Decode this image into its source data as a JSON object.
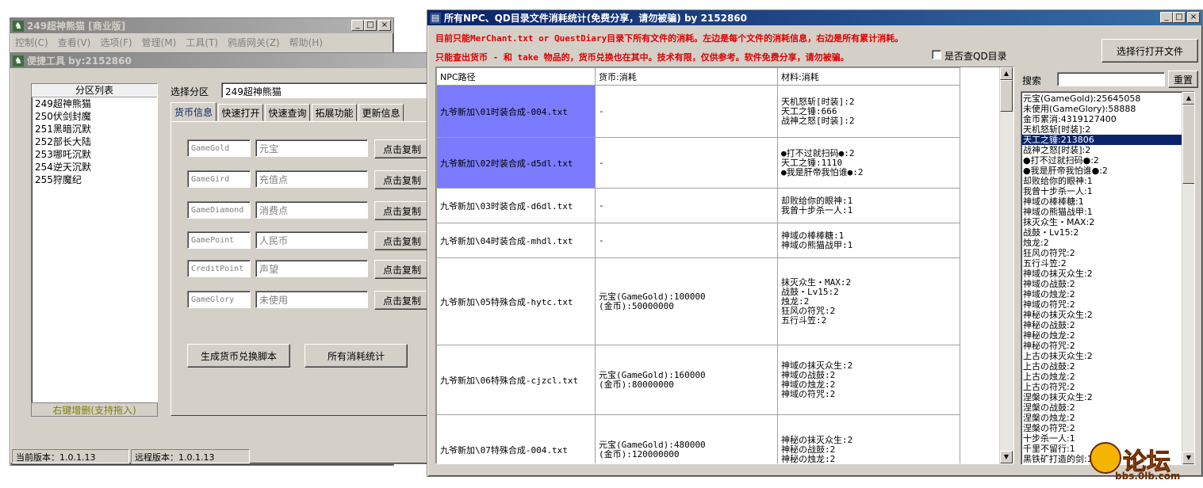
{
  "main_window": {
    "title": "249超神熊猫 [商业版]",
    "menu": [
      "控制(C)",
      "查看(V)",
      "选项(F)",
      "管理(M)",
      "工具(T)",
      "鸦盾网关(Z)",
      "帮助(H)"
    ]
  },
  "tool_window": {
    "title": "便捷工具   by:2152860",
    "partition_list_header": "分区列表",
    "partitions": [
      "249超神熊猫",
      "250伏剑封魔",
      "251黑暗沉默",
      "252部长大陆",
      "253哪吒沉默",
      "254逆天沉默",
      "255狩魔纪"
    ],
    "list_footer": "右键增删(支持拖入)",
    "select_partition_label": "选择分区",
    "selected_partition": "249超神熊猫",
    "tabs": [
      "货币信息",
      "快速打开",
      "快速查询",
      "拓展功能",
      "更新信息"
    ],
    "currency_rows": [
      {
        "code": "GameGold",
        "name": "元宝",
        "button": "点击复制"
      },
      {
        "code": "GameGird",
        "name": "充值点",
        "button": "点击复制"
      },
      {
        "code": "GameDiamond",
        "name": "消费点",
        "button": "点击复制"
      },
      {
        "code": "GamePoint",
        "name": "人民币",
        "button": "点击复制"
      },
      {
        "code": "CreditPoint",
        "name": "声望",
        "button": "点击复制"
      },
      {
        "code": "GameGlory",
        "name": "未使用",
        "button": "点击复制"
      }
    ],
    "generate_button": "生成货币兑换脚本",
    "stats_button": "所有消耗统计",
    "current_version": "当前版本：1.0.1.13",
    "remote_version": "远程版本：1.0.1.13"
  },
  "stats_window": {
    "title": "所有NPC、QD目录文件消耗统计(免费分享，请勿被骗)     by 2152860",
    "notice_line1": "目前只能MerChant.txt or QuestDiary目录下所有文件的消耗。左边是每个文件的消耗信息，右边是所有累计消耗。",
    "notice_line2": "只能查出货币 - 和 take 物品的，货币兑换也在其中。技术有限，仅供参考。软件免费分享，请勿被骗。",
    "checkbox_label": "是否查QD目录",
    "open_file_button": "选择行打开文件",
    "search_label": "搜索",
    "search_value": "",
    "reset_button": "重置",
    "table_headers": [
      "NPC路径",
      "货币:消耗",
      "材料:消耗"
    ],
    "rows": [
      {
        "path": "九爷新加\\01时装合成-004.txt",
        "currency": [
          "-"
        ],
        "materials": [
          "天机怒斩[时装]:2",
          "天工之锤:666",
          "战神之怒[时装]:2"
        ],
        "selected": true
      },
      {
        "path": "九爷新加\\02时装合成-d5dl.txt",
        "currency": [
          "-"
        ],
        "materials": [
          "●打不过就扫码●:2",
          "天工之锤:1110",
          "●我是肝帝我怕谁●:2"
        ],
        "selected": true
      },
      {
        "path": "九爷新加\\03时装合成-d6dl.txt",
        "currency": [
          "-"
        ],
        "materials": [
          "却败给你的眼神:1",
          "我曾十步杀一人:1"
        ],
        "selected": false
      },
      {
        "path": "九爷新加\\04时装合成-mhdl.txt",
        "currency": [
          "-"
        ],
        "materials": [
          "神域の棒棒糖:1",
          "神域の熊猫战甲:1"
        ],
        "selected": false
      },
      {
        "path": "九爷新加\\05特殊合成-hytc.txt",
        "currency": [
          "元宝(GameGold):100000",
          "(金币):50000000"
        ],
        "materials": [
          "抹灭众生・MAX:2",
          "战鼓・Lv15:2",
          "烛龙:2",
          "狂风の符咒:2",
          "五行斗笠:2"
        ],
        "selected": false
      },
      {
        "path": "九爷新加\\06特殊合成-cjzcl.txt",
        "currency": [
          "元宝(GameGold):160000",
          "(金币):80000000"
        ],
        "materials": [
          "神域の抹灭众生:2",
          "神域の战鼓:2",
          "神域の烛龙:2",
          "神域の符咒:2"
        ],
        "selected": false
      },
      {
        "path": "九爷新加\\07特殊合成-004.txt",
        "currency": [
          "元宝(GameGold):480000",
          "(金币):120000000"
        ],
        "materials": [
          "神秘の抹灭众生:2",
          "神秘の战鼓:2",
          "神秘の烛龙:2"
        ],
        "selected": false
      }
    ],
    "summary": [
      "元宝(GameGold):25645058",
      "未使用(GameGlory):58888",
      "金币累消:4319127400",
      "天机怒斩[时装]:2",
      "天工之锤:213806",
      "战神之怒[时装]:2",
      "●打不过就扫码●:2",
      "●我是肝帝我怕谁●:2",
      "却败给你的眼神:1",
      "我曾十步杀一人:1",
      "神域の棒棒糖:1",
      "神域の熊猫战甲:1",
      "抹灭众生・MAX:2",
      "战鼓・Lv15:2",
      "烛龙:2",
      "狂风の符咒:2",
      "五行斗笠:2",
      "神域の抹灭众生:2",
      "神域の战鼓:2",
      "神域の烛龙:2",
      "神域の符咒:2",
      "神秘の抹灭众生:2",
      "神秘の战鼓:2",
      "神秘の烛龙:2",
      "神秘の符咒:2",
      "上古の抹灭众生:2",
      "上古の战鼓:2",
      "上古の烛龙:2",
      "上古の符咒:2",
      "涅槃の抹灭众生:2",
      "涅槃の战鼓:2",
      "涅槃の烛龙:2",
      "涅槃の符咒:2",
      "十步杀一人:1",
      "千里不留行:1",
      "黑铁矿打造的剑:1"
    ],
    "summary_selected_index": 4
  },
  "watermark": {
    "text": "论坛",
    "url": "bbs.0lb.com"
  },
  "colors": {
    "title_active": "#0a246a",
    "selection": "#7b7bff",
    "notice_red": "#e00000"
  }
}
